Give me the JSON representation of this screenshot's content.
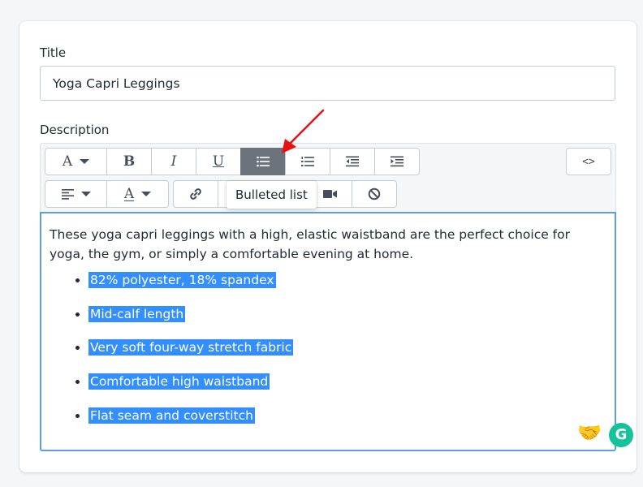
{
  "form": {
    "title_label": "Title",
    "title_value": "Yoga Capri Leggings",
    "description_label": "Description"
  },
  "toolbar": {
    "row1": [
      {
        "name": "font-style-dropdown",
        "glyph": "A",
        "caret": true
      },
      {
        "name": "bold-button",
        "glyph": "B"
      },
      {
        "name": "italic-button",
        "glyph": "I"
      },
      {
        "name": "underline-button",
        "glyph": "U"
      },
      {
        "name": "bulleted-list-button",
        "glyph": "",
        "active": true
      },
      {
        "name": "numbered-list-button",
        "glyph": ""
      },
      {
        "name": "outdent-button",
        "glyph": ""
      },
      {
        "name": "indent-button",
        "glyph": ""
      }
    ],
    "html_toggle": "<>",
    "tooltip": "Bulleted list"
  },
  "editor": {
    "intro": "These yoga capri leggings with a high, elastic waistband are the perfect choice for yoga, the gym, or simply a comfortable evening at home.",
    "bullets": [
      "82% polyester, 18% spandex",
      "Mid-calf length",
      "Very soft four-way stretch fabric",
      "Comfortable high waistband",
      "Flat seam and coverstitch"
    ]
  },
  "grammarly": {
    "letter": "G"
  },
  "hand_emoji": "🤝",
  "colors": {
    "active_button": "#6d737a",
    "selection": "#338fff",
    "focus_border": "#5c9ee6",
    "annotation_arrow": "#e8110f"
  }
}
